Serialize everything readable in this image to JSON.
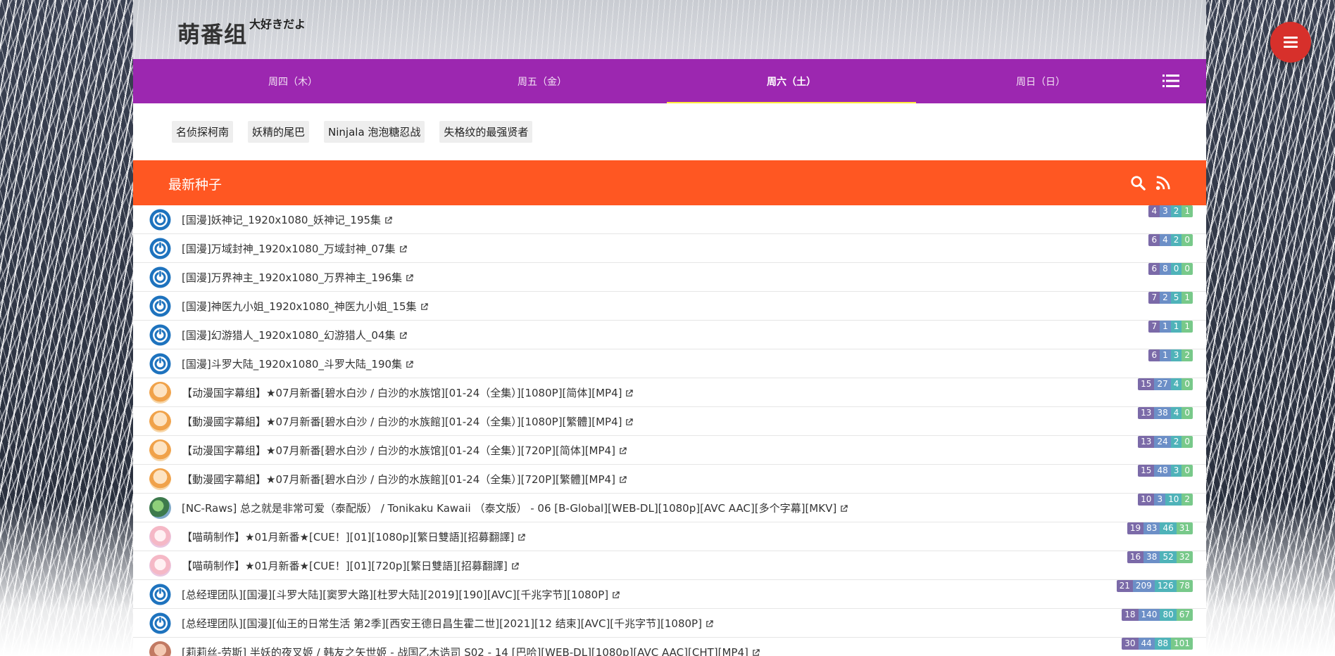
{
  "site": {
    "title": "萌番组",
    "subtitle": "大好きだよ"
  },
  "nav": {
    "tabs": [
      {
        "label": "周四（木）"
      },
      {
        "label": "周五（金）"
      },
      {
        "label": "周六（土）"
      },
      {
        "label": "周日（日）"
      }
    ],
    "active_tab": "周六（土）"
  },
  "tags": [
    "名侦探柯南",
    "妖精的尾巴",
    "Ninjala 泡泡糖忍战",
    "失格纹的最强贤者"
  ],
  "seeds": {
    "header": "最新种子",
    "rows": [
      {
        "title": "[国漫]妖神记_1920x1080_妖神记_195集",
        "counts": [
          "4",
          "3",
          "2",
          "1"
        ],
        "avatar": "power"
      },
      {
        "title": "[国漫]万域封神_1920x1080_万域封神_07集",
        "counts": [
          "6",
          "4",
          "2",
          "0"
        ],
        "avatar": "power"
      },
      {
        "title": "[国漫]万界神主_1920x1080_万界神主_196集",
        "counts": [
          "6",
          "8",
          "0",
          "0"
        ],
        "avatar": "power"
      },
      {
        "title": "[国漫]神医九小姐_1920x1080_神医九小姐_15集",
        "counts": [
          "7",
          "2",
          "5",
          "1"
        ],
        "avatar": "power"
      },
      {
        "title": "[国漫]幻游猎人_1920x1080_幻游猎人_04集",
        "counts": [
          "7",
          "1",
          "1",
          "1"
        ],
        "avatar": "power"
      },
      {
        "title": "[国漫]斗罗大陆_1920x1080_斗罗大陆_190集",
        "counts": [
          "6",
          "1",
          "3",
          "2"
        ],
        "avatar": "power"
      },
      {
        "title": "【动漫国字幕组】★07月新番[碧水白沙 / 白沙的水族馆][01-24（全集）][1080P][简体][MP4]",
        "counts": [
          "15",
          "27",
          "4",
          "0"
        ],
        "avatar": "anime"
      },
      {
        "title": "【動漫國字幕組】★07月新番[碧水白沙 / 白沙的水族館][01-24（全集）][1080P][繁體][MP4]",
        "counts": [
          "13",
          "38",
          "4",
          "0"
        ],
        "avatar": "anime"
      },
      {
        "title": "【动漫国字幕组】★07月新番[碧水白沙 / 白沙的水族馆][01-24（全集）][720P][简体][MP4]",
        "counts": [
          "13",
          "24",
          "2",
          "0"
        ],
        "avatar": "anime"
      },
      {
        "title": "【動漫國字幕組】★07月新番[碧水白沙 / 白沙的水族館][01-24（全集）][720P][繁體][MP4]",
        "counts": [
          "15",
          "48",
          "3",
          "0"
        ],
        "avatar": "anime"
      },
      {
        "title": "[NC-Raws] 总之就是非常可爱（泰配版） / Tonikaku Kawaii （泰文版） - 06 [B-Global][WEB-DL][1080p][AVC AAC][多个字幕][MKV]",
        "counts": [
          "10",
          "3",
          "10",
          "2"
        ],
        "avatar": "nc"
      },
      {
        "title": "【喵萌制作】★01月新番★[CUE！][01][1080p][繁日雙語][招募翻譯]",
        "counts": [
          "19",
          "83",
          "46",
          "31"
        ],
        "avatar": "miao"
      },
      {
        "title": "【喵萌制作】★01月新番★[CUE！][01][720p][繁日雙語][招募翻譯]",
        "counts": [
          "16",
          "38",
          "52",
          "32"
        ],
        "avatar": "miao"
      },
      {
        "title": "[总经理团队][国漫][斗罗大陆][窦罗大路][杜罗大陆][2019][190][AVC][千兆字节][1080P]",
        "counts": [
          "21",
          "209",
          "126",
          "78"
        ],
        "avatar": "power"
      },
      {
        "title": "[总经理团队][国漫][仙王的日常生活 第2季][西安王德日昌生霍二世][2021][12 结束][AVC][千兆字节][1080P]",
        "counts": [
          "18",
          "140",
          "80",
          "67"
        ],
        "avatar": "power"
      },
      {
        "title": "[莉莉丝-劳斯] 半妖的夜叉姬 / 韩友之矢世姬 - 战国乙木诰司 S02 - 14 [巴哈][WEB-DL][1080p][AVC AAC][CHT][MP4]",
        "counts": [
          "30",
          "44",
          "88",
          "101"
        ],
        "avatar": "lili"
      }
    ]
  },
  "icons": {
    "menu_fab": "menu-icon",
    "list": "list-icon",
    "search": "search-icon",
    "rss": "rss-icon",
    "external": "external-link-icon",
    "power": "power-icon"
  },
  "colors": {
    "nav": "#9c27b0",
    "seed_header": "#ff5722",
    "fab": "#d7302b",
    "count1": "#7b6aa8",
    "count2": "#6c8fc7",
    "count3": "#4fb3b9",
    "count4": "#78c98a"
  }
}
